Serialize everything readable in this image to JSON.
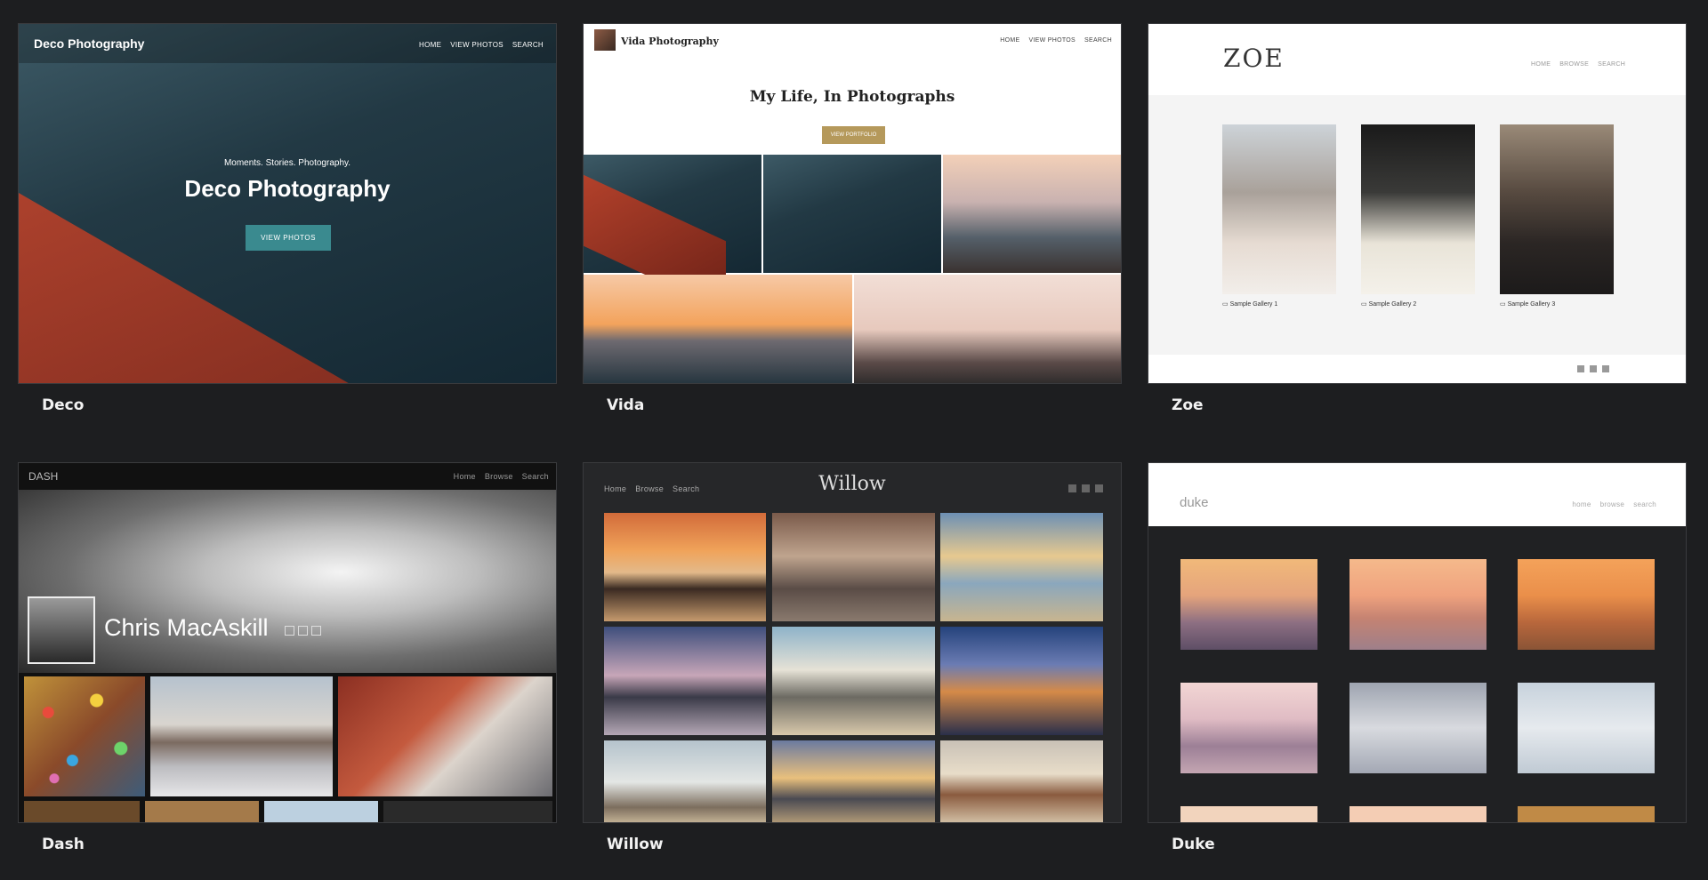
{
  "themes": [
    {
      "name": "Deco",
      "site_title": "Deco Photography",
      "nav": [
        "HOME",
        "VIEW PHOTOS",
        "SEARCH"
      ],
      "tagline": "Moments. Stories. Photography.",
      "hero_title": "Deco Photography",
      "cta": "VIEW PHOTOS"
    },
    {
      "name": "Vida",
      "site_title": "Vida Photography",
      "nav": [
        "HOME",
        "VIEW PHOTOS",
        "SEARCH"
      ],
      "hero_title": "My Life, In Photographs",
      "cta": "VIEW PORTFOLIO"
    },
    {
      "name": "Zoe",
      "site_title": "ZOE",
      "nav": [
        "HOME",
        "BROWSE",
        "SEARCH"
      ],
      "galleries": [
        "Sample Gallery 1",
        "Sample Gallery 2",
        "Sample Gallery 3"
      ]
    },
    {
      "name": "Dash",
      "site_title": "DASH",
      "nav": [
        "Home",
        "Browse",
        "Search"
      ],
      "profile_name": "Chris MacAskill"
    },
    {
      "name": "Willow",
      "site_title": "Willow",
      "nav": [
        "Home",
        "Browse",
        "Search"
      ]
    },
    {
      "name": "Duke",
      "site_title": "duke",
      "nav": [
        "home",
        "browse",
        "search"
      ]
    }
  ],
  "colors": {
    "background": "#1d1e20",
    "deco_cta": "#3a8a8f",
    "vida_cta": "#b5995b"
  },
  "icons": {
    "social": [
      "facebook-icon",
      "twitter-icon",
      "share-icon"
    ]
  }
}
